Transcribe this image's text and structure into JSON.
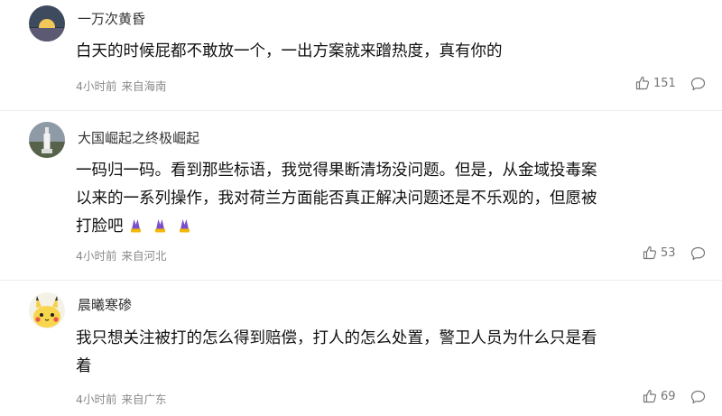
{
  "comments": [
    {
      "username": "一万次黄昏",
      "lines": [
        "白天的时候屁都不敢放一个，一出方案就来蹭热度，真有你的"
      ],
      "emojis": [],
      "time": "4小时前",
      "location": "来自海南",
      "likes": "151",
      "avatar": "sunset-avatar",
      "like_icon": "thumbs-up-icon",
      "reply_icon": "comment-bubble-icon"
    },
    {
      "username": "大国崛起之终极崛起",
      "lines": [
        "一码归一码。看到那些标语，我觉得果断清场没问题。但是，从金域投毒案",
        "以来的一系列操作，我对荷兰方面能否真正解决问题还是不乐观的，但愿被",
        "打脸吧"
      ],
      "emojis": [
        "praying-hands-emoji",
        "praying-hands-emoji",
        "praying-hands-emoji"
      ],
      "time": "4小时前",
      "location": "来自河北",
      "likes": "53",
      "avatar": "statue-avatar",
      "like_icon": "thumbs-up-icon",
      "reply_icon": "comment-bubble-icon"
    },
    {
      "username": "晨曦寒碜",
      "lines": [
        "我只想关注被打的怎么得到赔偿，打人的怎么处置，警卫人员为什么只是看",
        "着"
      ],
      "emojis": [],
      "time": "4小时前",
      "location": "来自广东",
      "likes": "69",
      "avatar": "pikachu-avatar",
      "like_icon": "thumbs-up-icon",
      "reply_icon": "comment-bubble-icon"
    }
  ],
  "colors": {
    "text": "#111111",
    "meta": "#8a8a8a",
    "divider": "#ededed",
    "emoji_purple": "#7a4fc9",
    "emoji_gold": "#f2b705"
  }
}
